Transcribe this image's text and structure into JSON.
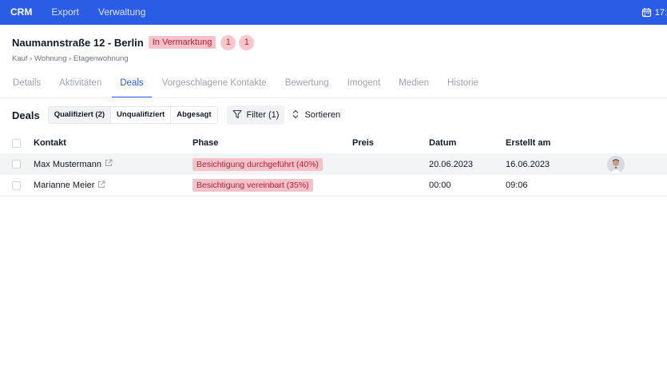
{
  "topbar": {
    "brand": "CRM",
    "nav": [
      "Export",
      "Verwaltung"
    ],
    "time": "17:",
    "calendar_icon": "calendar-icon"
  },
  "property": {
    "title": "Naumannstraße 12 - Berlin",
    "status": "In Vermarktung",
    "counters": [
      "1",
      "1"
    ],
    "breadcrumb": "Kauf › Wohnung › Etagenwohnung"
  },
  "tabs": [
    {
      "label": "Details",
      "active": false
    },
    {
      "label": "Aktivitäten",
      "active": false
    },
    {
      "label": "Deals",
      "active": true
    },
    {
      "label": "Vorgeschlagene Kontakte",
      "active": false
    },
    {
      "label": "Bewertung",
      "active": false
    },
    {
      "label": "Imogent",
      "active": false
    },
    {
      "label": "Medien",
      "active": false
    },
    {
      "label": "Historie",
      "active": false
    }
  ],
  "toolbar": {
    "label": "Deals",
    "segments": [
      "Qualifiziert (2)",
      "Unqualifiziert",
      "Abgesagt"
    ],
    "active_segment": 0,
    "filter": "Filter (1)",
    "sort": "Sortieren"
  },
  "table": {
    "columns": {
      "contact": "Kontakt",
      "phase": "Phase",
      "price": "Preis",
      "date": "Datum",
      "created": "Erstellt am"
    },
    "rows": [
      {
        "contact": "Max Mustermann",
        "phase": "Besichtigung durchgeführt (40%)",
        "price": "",
        "date": "20.06.2023",
        "created": "16.06.2023",
        "has_avatar": true
      },
      {
        "contact": "Marianne Meier",
        "phase": "Besichtigung vereinbart (35%)",
        "price": "",
        "date": "00:00",
        "created": "09:06",
        "has_avatar": false
      }
    ]
  },
  "colors": {
    "accent": "#2b5ce6",
    "badge_bg": "#f4c2c8",
    "badge_text": "#b4233a"
  }
}
